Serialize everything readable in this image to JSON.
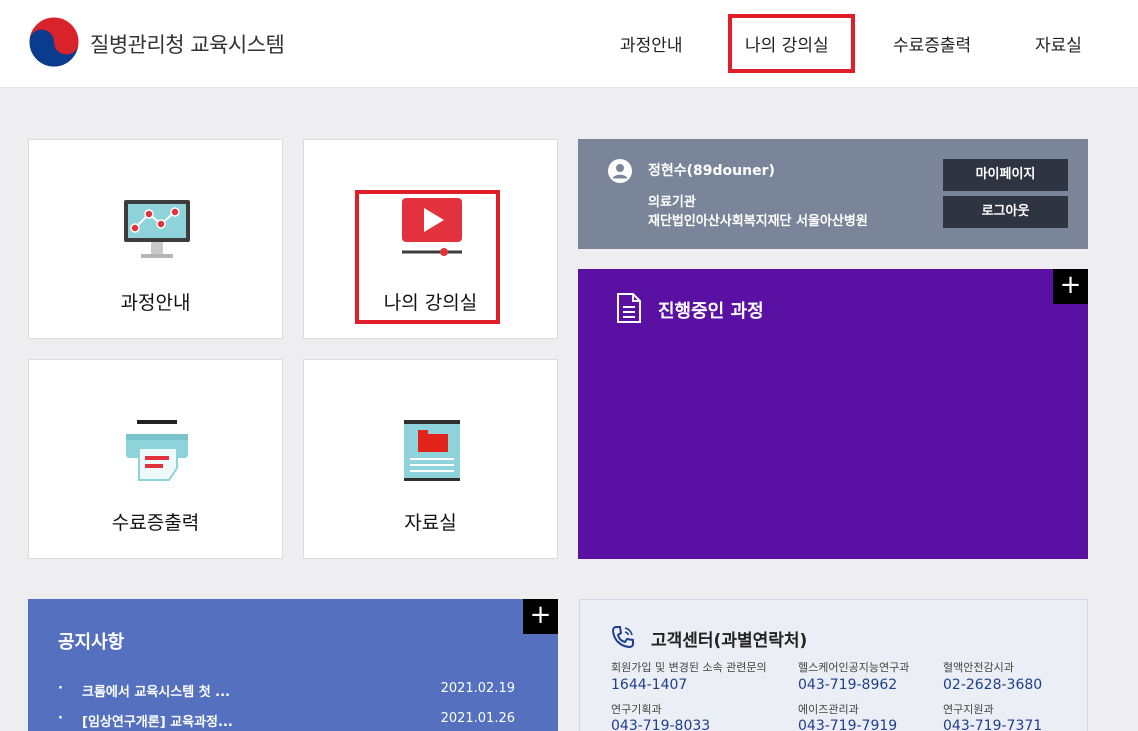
{
  "header": {
    "brand": "질병관리청 교육시스템",
    "nav": [
      "과정안내",
      "나의 강의실",
      "수료증출력",
      "자료실"
    ]
  },
  "tiles": [
    "과정안내",
    "나의 강의실",
    "수료증출력",
    "자료실"
  ],
  "user": {
    "name": "정현수(89douner)",
    "org_type": "의료기관",
    "org_name": "재단법인아산사회복지재단 서울아산병원",
    "mypage_label": "마이페이지",
    "logout_label": "로그아웃"
  },
  "courses": {
    "title": "진행중인 과정",
    "more_label": "+"
  },
  "notice": {
    "title": "공지사항",
    "more_label": "+",
    "items": [
      {
        "bullet": "·",
        "title": "크롬에서 교육시스템 첫 ...",
        "date": "2021.02.19"
      },
      {
        "bullet": "·",
        "title": "[임상연구개론] 교육과정...",
        "date": "2021.01.26"
      }
    ]
  },
  "contact": {
    "title": "고객센터(과별연락처)",
    "entries": [
      {
        "label": "회원가입 및 변경된 소속 관련문의",
        "number": "1644-1407"
      },
      {
        "label": "헬스케어인공지능연구과",
        "number": "043-719-8962"
      },
      {
        "label": "혈액안전감시과",
        "number": "02-2628-3680"
      },
      {
        "label": "연구기획과",
        "number": "043-719-8033"
      },
      {
        "label": "에이즈관리과",
        "number": "043-719-7919"
      },
      {
        "label": "연구지원과",
        "number": "043-719-7371"
      }
    ]
  },
  "colors": {
    "highlight": "#e01e2a",
    "userbox": "#7b8599",
    "courses": "#5a10a3",
    "notice": "#5470bf",
    "contact_number": "#1f3f8f"
  },
  "icons": {
    "logo": "taegeuk-logo-icon",
    "user": "user-icon",
    "courses": "document-icon",
    "contact": "phone-icon",
    "tile_course_info": "monitor-chart-icon",
    "tile_my_classroom": "play-video-icon",
    "tile_certificate": "printer-icon",
    "tile_resources": "folder-document-icon"
  }
}
